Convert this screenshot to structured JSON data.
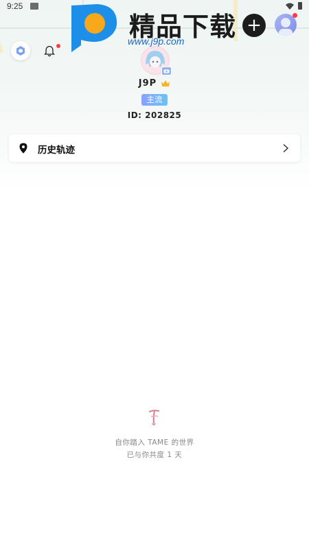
{
  "status_bar": {
    "time": "9:25",
    "wifi_icon": "wifi-icon",
    "battery_icon": "battery-icon"
  },
  "watermark": {
    "title": "精品下载",
    "url": "www.j9p.com"
  },
  "header": {
    "add_label": "+",
    "settings_icon": "hexagon-settings-icon",
    "bell_icon": "bell-icon"
  },
  "profile": {
    "name": "J9P",
    "tag": "主流",
    "id_text": "ID: 202825"
  },
  "history": {
    "label": "历史轨迹"
  },
  "footer": {
    "line1": "自你踏入 TAME 的世界",
    "line2": "已与你共度 1 天"
  },
  "colors": {
    "accent_red": "#ff3b4a",
    "tag_gradient_start": "#8aa0ff",
    "tag_gradient_end": "#67c3f3"
  }
}
